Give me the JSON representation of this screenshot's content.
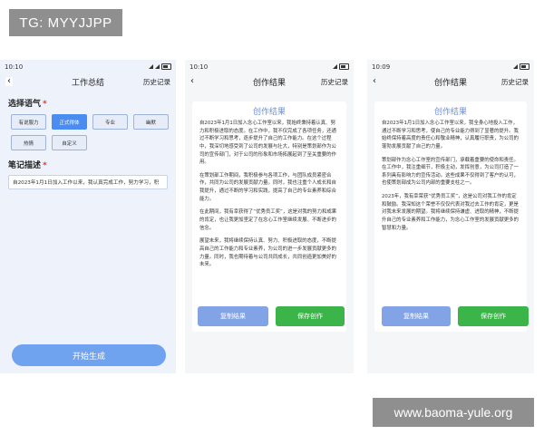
{
  "watermarks": {
    "top": "TG: MYYJJPP",
    "bottom": "www.baoma-yule.org"
  },
  "colors": {
    "accent": "#4a8cf0",
    "save": "#3bb54a",
    "copy": "#82a4e6",
    "title_blue": "#6c8fd2"
  },
  "screen1": {
    "time": "10:10",
    "title": "工作总结",
    "history": "历史记录",
    "tone_label": "选择语气",
    "tones": [
      "有说服力",
      "正式得体",
      "专业",
      "幽默",
      "热情",
      "自定义"
    ],
    "active_tone": "正式得体",
    "note_label": "笔记描述",
    "note_value": "自2023年1月1日加入工作以来，我认真完成工作，努力学习，积",
    "start_button": "开始生成"
  },
  "screen2": {
    "time": "10:10",
    "title": "创作结果",
    "history": "历史记录",
    "card_title": "创作结果",
    "paragraphs": [
      "自2023年1月1日加入念心工作室以来，我始终秉持着认真、努力和积极进取的态度。在工作中，我不仅完成了各项任务，还通过不断学习和思考，逐步提升了自己的工作能力。在这个过程中，我深切地感受到了公司的发展与壮大，特别是策划部作为公司的宣传部门，对于公司的形象和市场拓展起到了至关重要的作用。",
      "在策划部工作期间，我积极参与各项工作，与团队成员紧密合作，共同为公司的发展贡献力量。同时，我也注重个人成长和自我提升，通过不断的学习和实践，提高了自己的专业素养和综合能力。",
      "在此期间，我有幸获得了“优秀员工奖”，这是对我的努力和成果的肯定，也让我更加坚定了在念心工作室继续发展、不断进步的信念。",
      "展望未来，我将继续保持认真、努力、积极进取的态度，不断提高自己的工作能力和专业素养，为公司的进一步发展贡献更多的力量。同时，我也期待着与公司共同成长，共同创造更加美好的未来。"
    ],
    "copy_button": "复制结果",
    "save_button": "保存创作"
  },
  "screen3": {
    "time": "10:09",
    "title": "创作结果",
    "history": "历史记录",
    "card_title": "创作结果",
    "paragraphs": [
      "自2023年1月1日加入念心工作室以来，我全身心地投入工作，通过不断学习和思考，使自己的专业能力得到了显著的提升。我始终保持着高度的责任心和敬业精神，认真履行职责，为公司的蓬勃发展贡献了自己的力量。",
      "策划部作为念心工作室的宣传部门，承载着重要的使命和责任。在工作中，我注重细节，积极主动，发挥创意，为公司打造了一系列具有影响力的宣传活动。这些成果不仅得到了客户的认可，也使策划部成为公司内部的重要支柱之一。",
      "2023年，我有幸荣获“优秀员工奖”，这是公司对我工作的肯定和鼓励。我深知这个荣誉不仅仅代表对我过去工作的肯定，更是对我未来发展的期望。我将继续保持谦虚、进取的精神，不断提升自己的专业素养和工作能力，为念心工作室的发展贡献更多的智慧和力量。"
    ],
    "copy_button": "复制结果",
    "save_button": "保存创作"
  }
}
